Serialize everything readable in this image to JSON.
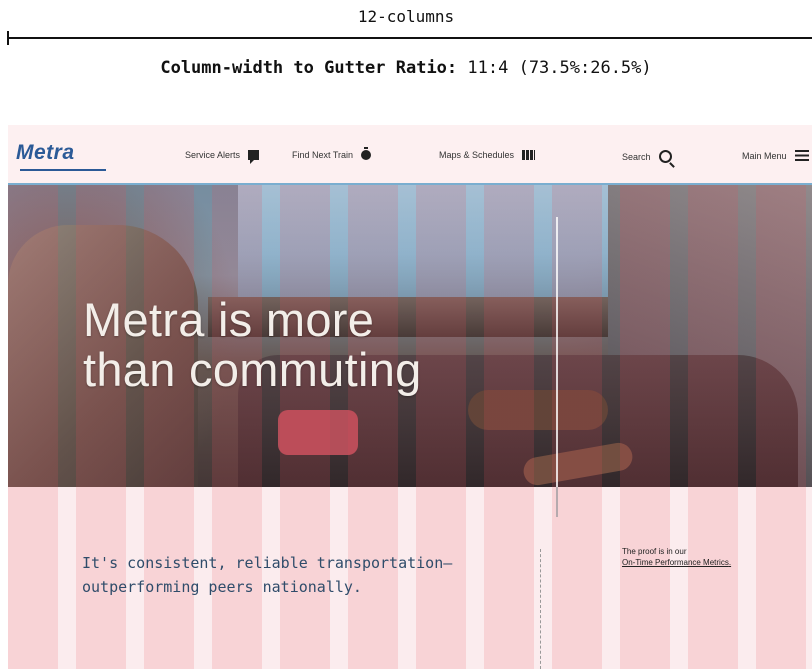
{
  "header": {
    "grid_label": "12-columns",
    "ratio_label": "Column-width to Gutter Ratio:",
    "ratio_value": "11:4 (73.5%:26.5%)"
  },
  "site": {
    "logo": "Metra",
    "nav": [
      {
        "label": "Service Alerts",
        "icon": "alert-icon"
      },
      {
        "label": "Find Next Train",
        "icon": "timer-icon"
      },
      {
        "label": "Maps & Schedules",
        "icon": "map-icon"
      },
      {
        "label": "Search",
        "icon": "search-icon"
      },
      {
        "label": "Main Menu",
        "icon": "menu-icon"
      }
    ],
    "hero": {
      "title_line1": "Metra is more",
      "title_line2": "than commuting"
    },
    "content": {
      "tagline_line1": "It's consistent, reliable transportation—",
      "tagline_line2": "outperforming peers nationally.",
      "proof_text": "The proof is in our",
      "proof_link": "On-Time Performance Metrics",
      "proof_suffix": "."
    }
  }
}
